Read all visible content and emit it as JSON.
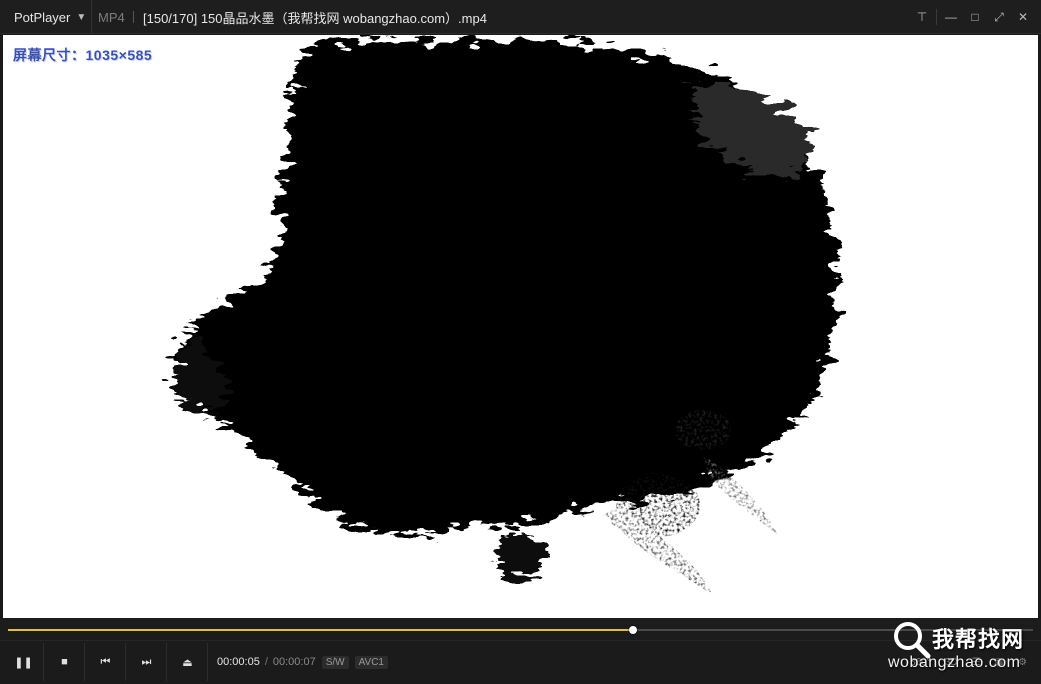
{
  "app": {
    "name": "PotPlayer",
    "format": "MP4",
    "file_title": "[150/170] 150晶品水墨（我帮找网 wobangzhao.com）.mp4"
  },
  "window_buttons": [
    {
      "name": "pin-icon",
      "glyph": "⊤"
    },
    {
      "name": "minimize-icon",
      "glyph": "—"
    },
    {
      "name": "maximize-icon",
      "glyph": "□"
    },
    {
      "name": "fullscreen-icon",
      "glyph": "⤢"
    },
    {
      "name": "close-icon",
      "glyph": "✕"
    }
  ],
  "video": {
    "osd_text": "屏幕尺寸：1035×585"
  },
  "seek": {
    "progress": 0.61,
    "fill_color": "#e6c12a"
  },
  "controls": {
    "buttons": [
      {
        "name": "pause-icon",
        "glyph": "❚❚"
      },
      {
        "name": "stop-icon",
        "glyph": "■"
      },
      {
        "name": "previous-icon",
        "glyph": "⏮"
      },
      {
        "name": "next-icon",
        "glyph": "⏭"
      },
      {
        "name": "eject-icon",
        "glyph": "⏏"
      }
    ],
    "current_time": "00:00:05",
    "separator": "/",
    "total_time": "00:00:07",
    "tags": [
      "S/W",
      "AVC1"
    ],
    "right_labels": [
      "360°",
      "3D",
      "☰",
      "▣",
      "⚙"
    ]
  },
  "watermark": {
    "chinese": "我帮找网",
    "english": "wobangzhao.com"
  }
}
